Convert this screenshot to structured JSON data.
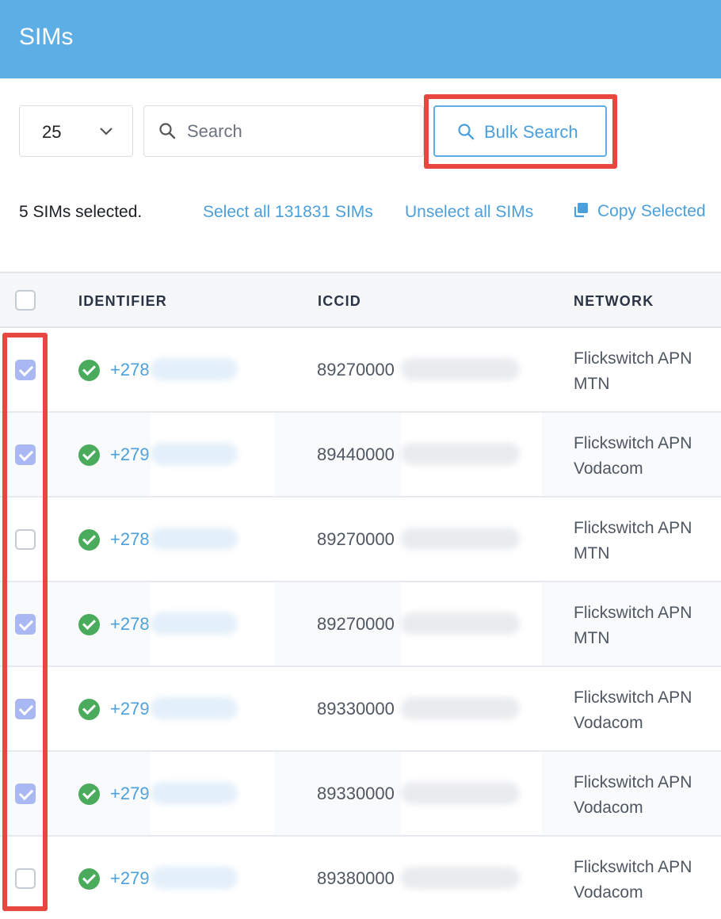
{
  "header": {
    "title": "SIMs"
  },
  "toolbar": {
    "per_page": "25",
    "search_placeholder": "Search",
    "bulk_search_label": "Bulk Search"
  },
  "selection": {
    "count_text": "5 SIMs selected.",
    "select_all_label": "Select all 131831 SIMs",
    "unselect_all_label": "Unselect all SIMs",
    "copy_selected_label": "Copy Selected"
  },
  "table": {
    "columns": [
      "IDENTIFIER",
      "ICCID",
      "NETWORK"
    ],
    "rows": [
      {
        "checked": true,
        "identifier": "+278",
        "iccid": "89270000",
        "network_line1": "Flickswitch APN",
        "network_line2": "MTN"
      },
      {
        "checked": true,
        "identifier": "+279",
        "iccid": "89440000",
        "network_line1": "Flickswitch APN",
        "network_line2": "Vodacom"
      },
      {
        "checked": false,
        "identifier": "+278",
        "iccid": "89270000",
        "network_line1": "Flickswitch APN",
        "network_line2": "MTN"
      },
      {
        "checked": true,
        "identifier": "+278",
        "iccid": "89270000",
        "network_line1": "Flickswitch APN",
        "network_line2": "MTN"
      },
      {
        "checked": true,
        "identifier": "+279",
        "iccid": "89330000",
        "network_line1": "Flickswitch APN",
        "network_line2": "Vodacom"
      },
      {
        "checked": true,
        "identifier": "+279",
        "iccid": "89330000",
        "network_line1": "Flickswitch APN",
        "network_line2": "Vodacom"
      },
      {
        "checked": false,
        "identifier": "+279",
        "iccid": "89380000",
        "network_line1": "Flickswitch APN",
        "network_line2": "Vodacom"
      }
    ]
  },
  "colors": {
    "header": "#5eaee6",
    "link": "#4a9fdc",
    "highlight": "#e8473f",
    "status_ok": "#4aab5c",
    "checkbox_checked": "#a9b8f2"
  },
  "icons": {
    "perpage_chevron": "chevron-down-icon",
    "search": "search-icon",
    "copy": "copy-icon",
    "status": "check-circle-icon"
  }
}
